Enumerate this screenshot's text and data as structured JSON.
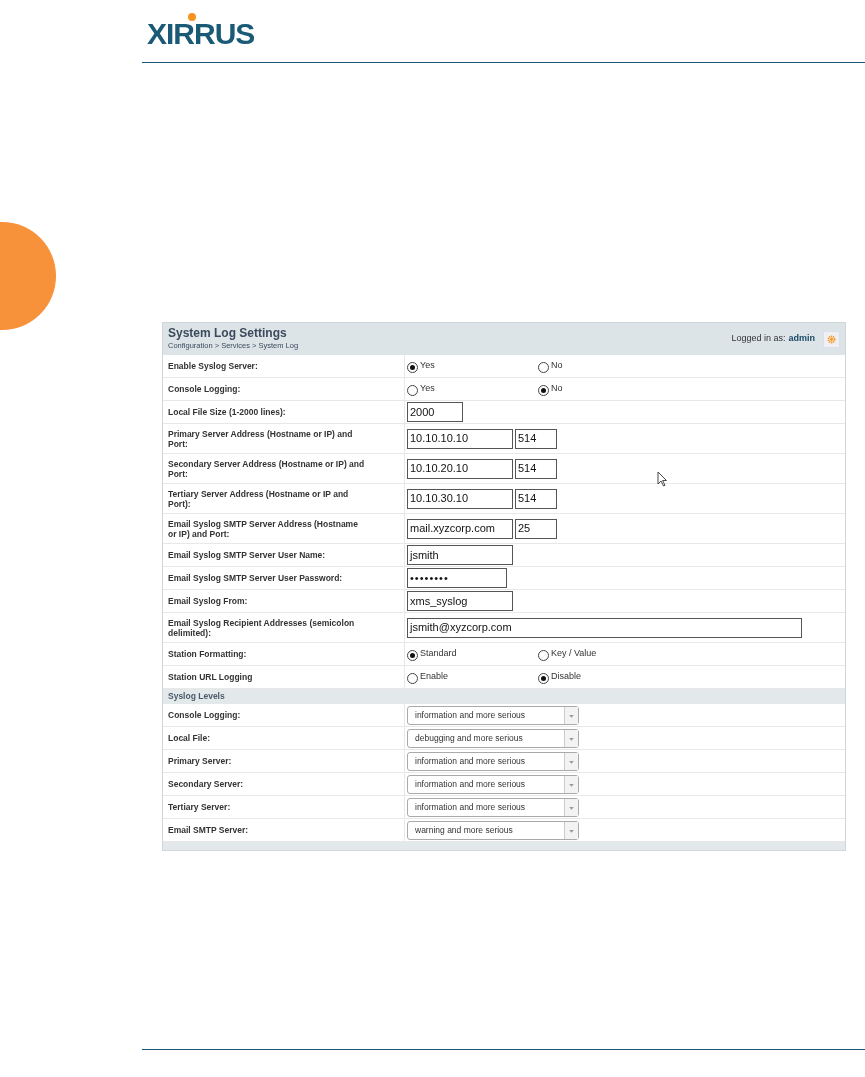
{
  "logo": {
    "text": "XIRRUS"
  },
  "panel": {
    "title": "System Log Settings",
    "breadcrumb": "Configuration > Services > System Log",
    "logged_in_label": "Logged in as:",
    "user": "admin"
  },
  "rows": [
    {
      "kind": "radio",
      "label": "Enable Syslog Server:",
      "options": [
        {
          "label": "Yes",
          "selected": true
        },
        {
          "label": "No",
          "selected": false
        }
      ]
    },
    {
      "kind": "radio",
      "label": "Console Logging:",
      "options": [
        {
          "label": "Yes",
          "selected": false
        },
        {
          "label": "No",
          "selected": true
        }
      ]
    },
    {
      "kind": "short_text",
      "label": "Local File Size (1-2000 lines):",
      "value": "2000"
    },
    {
      "kind": "pair",
      "label": "Primary Server Address (Hostname or IP) and Port:",
      "value": "10.10.10.10",
      "port": "514"
    },
    {
      "kind": "pair",
      "label": "Secondary Server Address (Hostname or IP) and Port:",
      "value": "10.10.20.10",
      "port": "514"
    },
    {
      "kind": "pair",
      "label": "Tertiary Server Address (Hostname or IP and Port):",
      "value": "10.10.30.10",
      "port": "514"
    },
    {
      "kind": "pair",
      "label": "Email Syslog SMTP Server Address (Hostname or IP) and Port:",
      "value": "mail.xyzcorp.com",
      "port": "25"
    },
    {
      "kind": "text",
      "label": "Email Syslog SMTP Server User Name:",
      "value": "jsmith"
    },
    {
      "kind": "password",
      "label": "Email Syslog SMTP Server User Password:",
      "value": "••••••••"
    },
    {
      "kind": "text",
      "label": "Email Syslog From:",
      "value": "xms_syslog"
    },
    {
      "kind": "wide_text",
      "label": "Email Syslog Recipient Addresses (semicolon delimited):",
      "value": "jsmith@xyzcorp.com"
    },
    {
      "kind": "radio",
      "label": "Station Formatting:",
      "options": [
        {
          "label": "Standard",
          "selected": true
        },
        {
          "label": "Key / Value",
          "selected": false
        }
      ]
    },
    {
      "kind": "radio",
      "label": "Station URL Logging",
      "options": [
        {
          "label": "Enable",
          "selected": false
        },
        {
          "label": "Disable",
          "selected": true
        }
      ]
    },
    {
      "kind": "section",
      "label": "Syslog Levels"
    },
    {
      "kind": "select",
      "label": "Console Logging:",
      "value": "information and more serious"
    },
    {
      "kind": "select",
      "label": "Local File:",
      "value": "debugging and more serious"
    },
    {
      "kind": "select",
      "label": "Primary Server:",
      "value": "information and more serious"
    },
    {
      "kind": "select",
      "label": "Secondary Server:",
      "value": "information and more serious"
    },
    {
      "kind": "select",
      "label": "Tertiary Server:",
      "value": "information and more serious"
    },
    {
      "kind": "select",
      "label": "Email SMTP Server:",
      "value": "warning and more serious"
    }
  ]
}
